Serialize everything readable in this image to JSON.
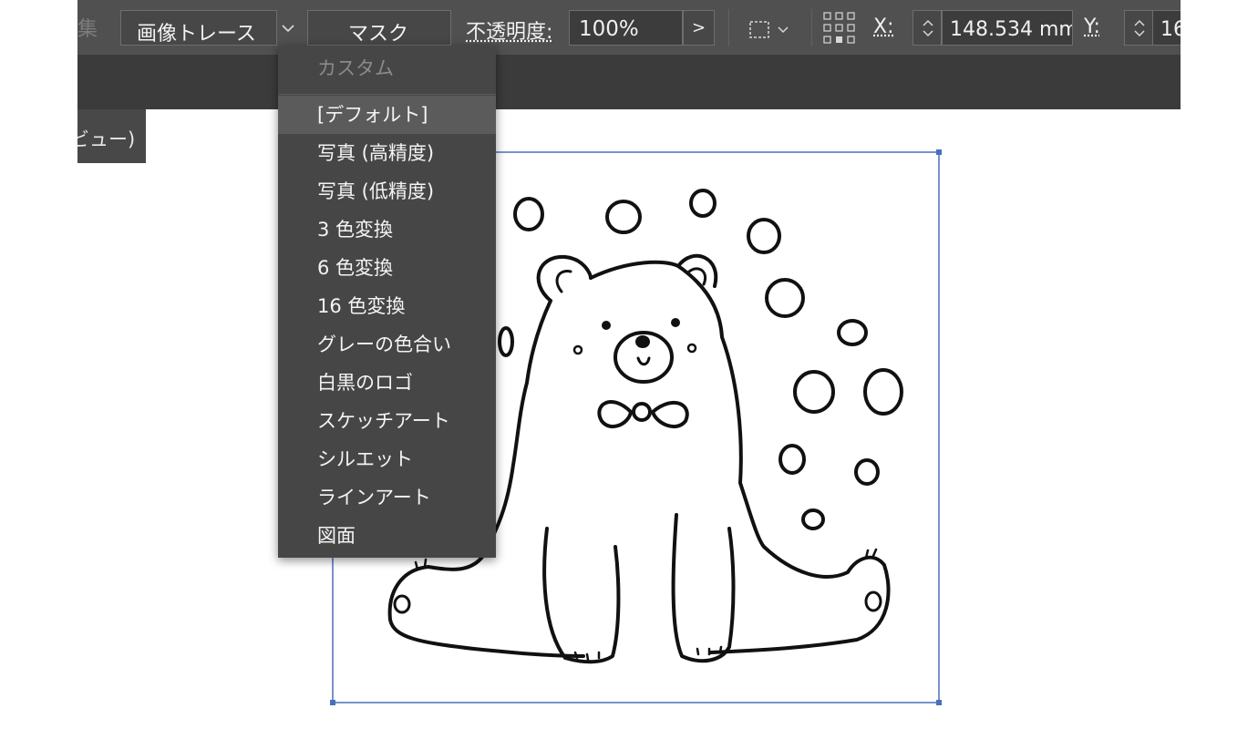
{
  "toolbar": {
    "edit_partial": "集",
    "trace_button": "画像トレース",
    "mask_button": "マスク",
    "opacity_label": "不透明度:",
    "opacity_value": "100%",
    "opacity_arrow": ">",
    "x_label": "X:",
    "x_value": "148.534 mm",
    "y_label": "Y:",
    "y_value": "16"
  },
  "tab": {
    "label": "ビュー)"
  },
  "preset_menu": {
    "header": "カスタム",
    "selected_index": 0,
    "items": [
      "[デフォルト]",
      "写真 (高精度)",
      "写真 (低精度)",
      "3 色変換",
      "6 色変換",
      "16 色変換",
      "グレーの色合い",
      "白黒のロゴ",
      "スケッチアート",
      "シルエット",
      "ラインアート",
      "図面"
    ]
  },
  "colors": {
    "selection": "#4a6fbf",
    "toolbar_bg": "#505050",
    "menu_bg": "#464646",
    "menu_highlight": "#5b5b5b"
  },
  "icons": [
    "chevron-down-icon",
    "marquee-select-icon",
    "reference-point-icon",
    "stepper-icon",
    "chevron-right-icon"
  ]
}
